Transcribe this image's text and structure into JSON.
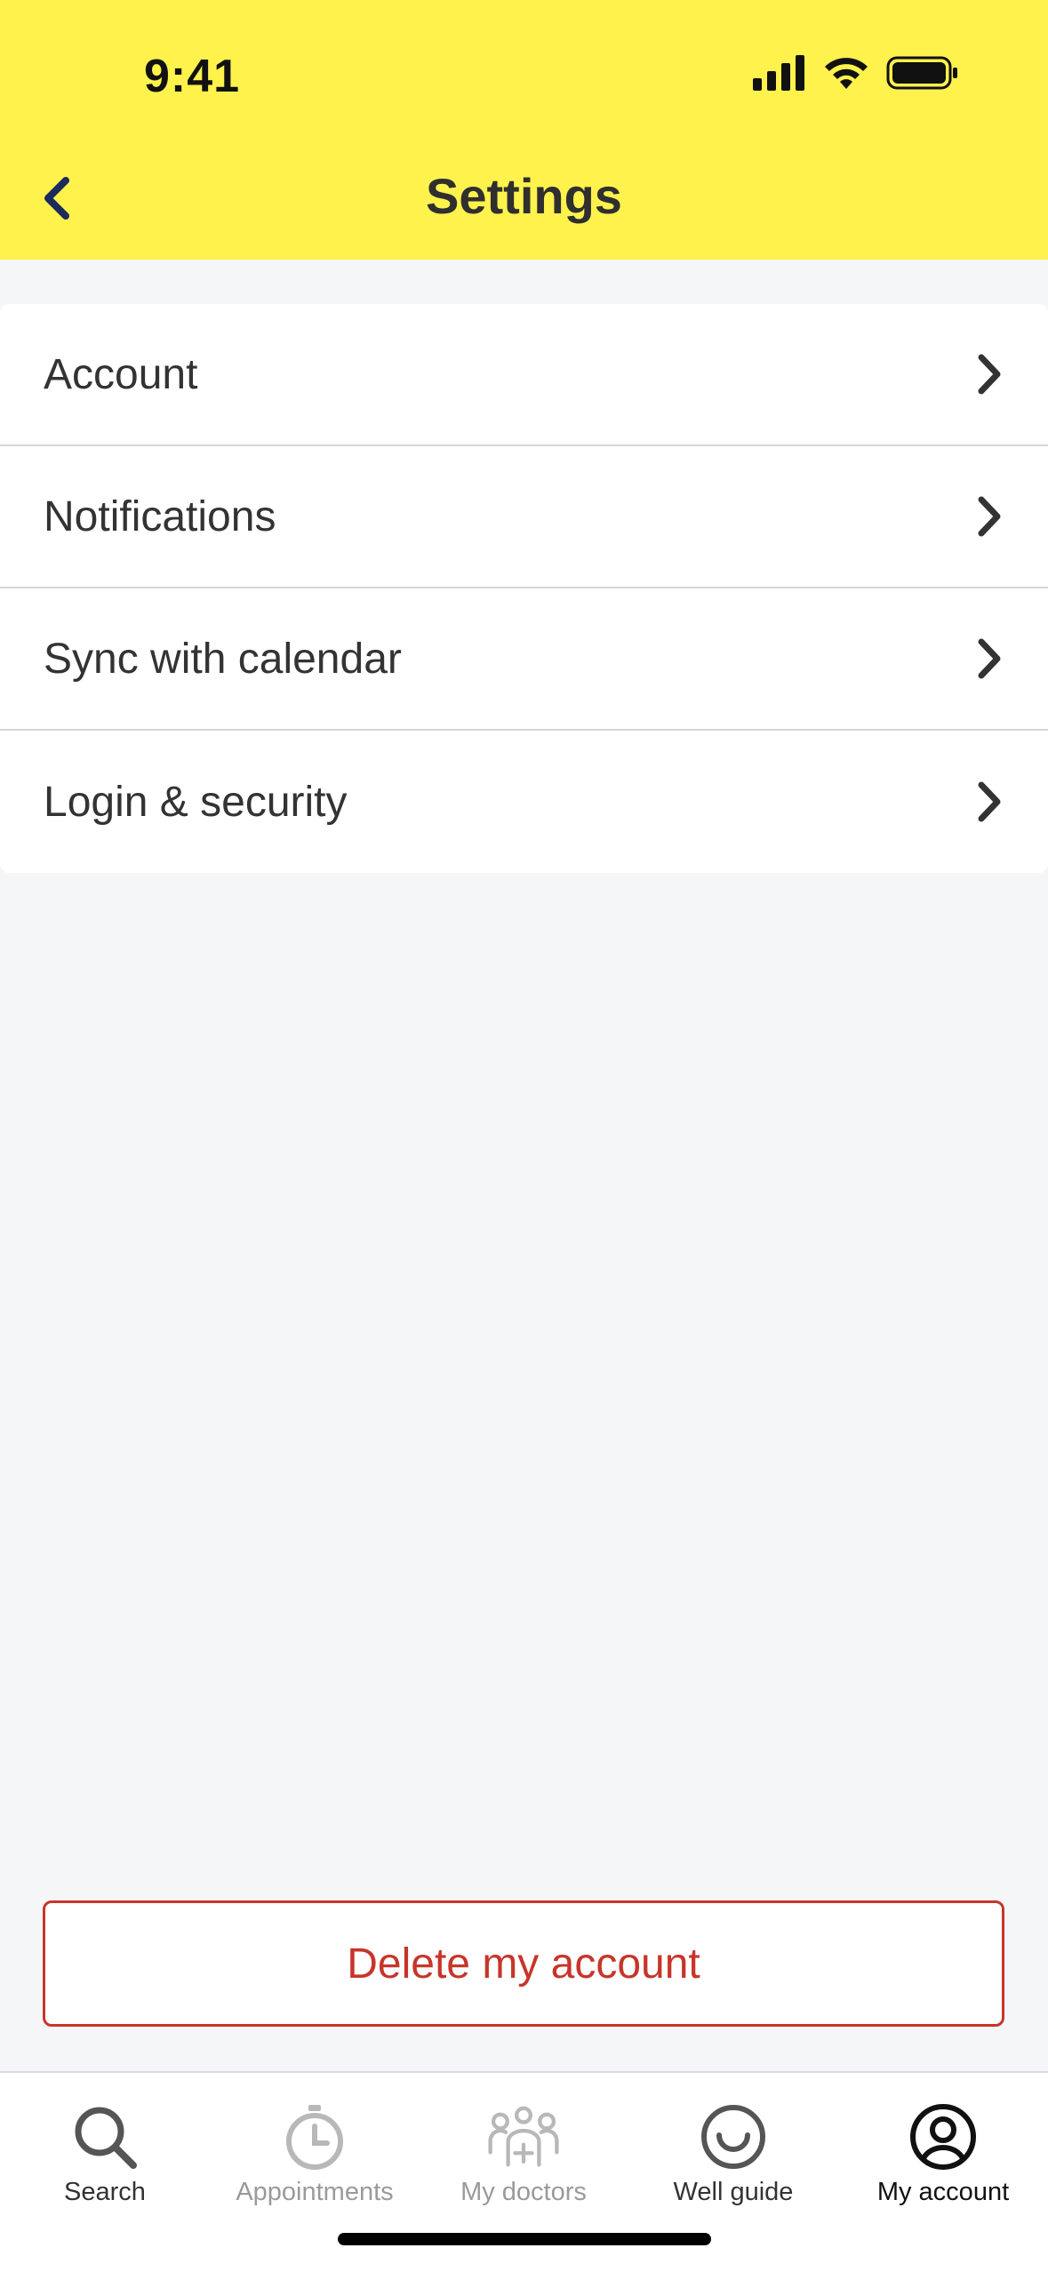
{
  "status_bar": {
    "time": "9:41",
    "icons": [
      "cellular-signal-icon",
      "wifi-icon",
      "battery-icon"
    ]
  },
  "header": {
    "title": "Settings",
    "back_icon": "chevron-left-icon",
    "background_color": "#fff24d"
  },
  "settings": {
    "items": [
      {
        "label": "Account"
      },
      {
        "label": "Notifications"
      },
      {
        "label": "Sync with calendar"
      },
      {
        "label": "Login & security"
      }
    ]
  },
  "delete_button": {
    "label": "Delete my account",
    "color": "#c7352a"
  },
  "tabbar": {
    "tabs": [
      {
        "label": "Search",
        "icon": "search-icon",
        "state": "dark"
      },
      {
        "label": "Appointments",
        "icon": "stopwatch-icon",
        "state": "inactive"
      },
      {
        "label": "My doctors",
        "icon": "doctors-group-icon",
        "state": "inactive"
      },
      {
        "label": "Well guide",
        "icon": "smile-icon",
        "state": "dark"
      },
      {
        "label": "My account",
        "icon": "account-icon",
        "state": "active"
      }
    ]
  }
}
